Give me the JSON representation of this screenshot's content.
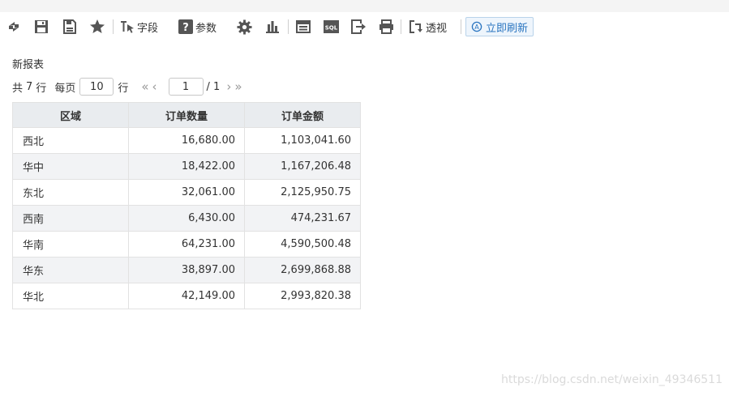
{
  "toolbar": {
    "field_label": "字段",
    "param_label": "参数",
    "perspective_label": "透视",
    "sql_label": "SQL",
    "refresh_now_label": "立即刷新"
  },
  "report": {
    "title": "新报表"
  },
  "pager": {
    "total_prefix": "共",
    "total_rows": "7",
    "total_suffix": "行",
    "per_page_label": "每页",
    "rows_per_page": "10",
    "rows_suffix": "行",
    "current_page": "1",
    "page_total": "/ 1"
  },
  "table": {
    "headers": [
      "区域",
      "订单数量",
      "订单金额"
    ],
    "rows": [
      [
        "西北",
        "16,680.00",
        "1,103,041.60"
      ],
      [
        "华中",
        "18,422.00",
        "1,167,206.48"
      ],
      [
        "东北",
        "32,061.00",
        "2,125,950.75"
      ],
      [
        "西南",
        "6,430.00",
        "474,231.67"
      ],
      [
        "华南",
        "64,231.00",
        "4,590,500.48"
      ],
      [
        "华东",
        "38,897.00",
        "2,699,868.88"
      ],
      [
        "华北",
        "42,149.00",
        "2,993,820.38"
      ]
    ]
  },
  "watermark": "https://blog.csdn.net/weixin_49346511"
}
